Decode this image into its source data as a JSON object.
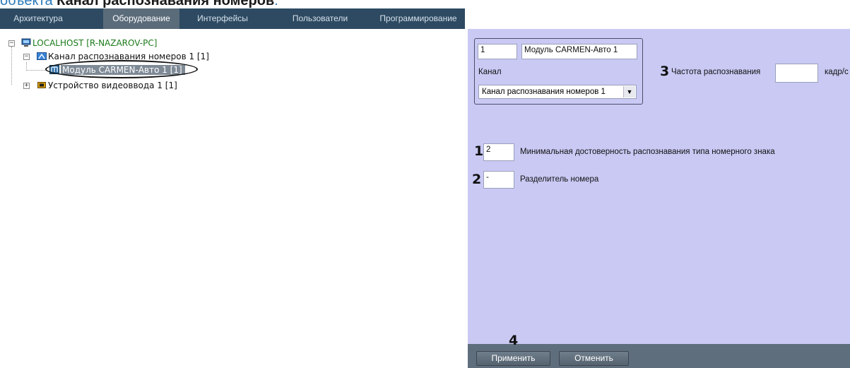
{
  "doc_heading": {
    "prefix": "объекта ",
    "bold": "Канал распознавания номеров",
    "suffix": "."
  },
  "tabs": [
    {
      "label": "Архитектура",
      "active": false
    },
    {
      "label": "Оборудование",
      "active": true
    },
    {
      "label": "Интерфейсы",
      "active": false
    },
    {
      "label": "Пользователи",
      "active": false
    },
    {
      "label": "Программирование",
      "active": false
    }
  ],
  "tree": {
    "root": "LOCALHOST [R-NAZAROV-PC]",
    "channel": "Канал распознавания номеров 1 [1]",
    "module": "Модуль CARMEN-Авто 1 [1]",
    "video": "Устройство видеоввода 1 [1]"
  },
  "settings": {
    "id_value": "1",
    "name_value": "Модуль CARMEN-Авто 1",
    "channel_label": "Канал",
    "channel_selected": "Канал распознавания номеров 1",
    "freq_label": "Частота распознавания",
    "freq_value": "",
    "freq_unit": "кадр/с",
    "min_conf_value": "2",
    "min_conf_label": "Минимальная достоверность распознавания типа номерного знака",
    "separator_value": "-",
    "separator_label": "Разделитель номера"
  },
  "callouts": {
    "c1": "1",
    "c2": "2",
    "c3": "3",
    "c4": "4"
  },
  "buttons": {
    "apply": "Применить",
    "cancel": "Отменить"
  },
  "colors": {
    "tabbar": "#2d4a62",
    "panel": "#c9c9f4",
    "selection": "#7e8a96",
    "bottom_bar": "#5f6e7d"
  }
}
